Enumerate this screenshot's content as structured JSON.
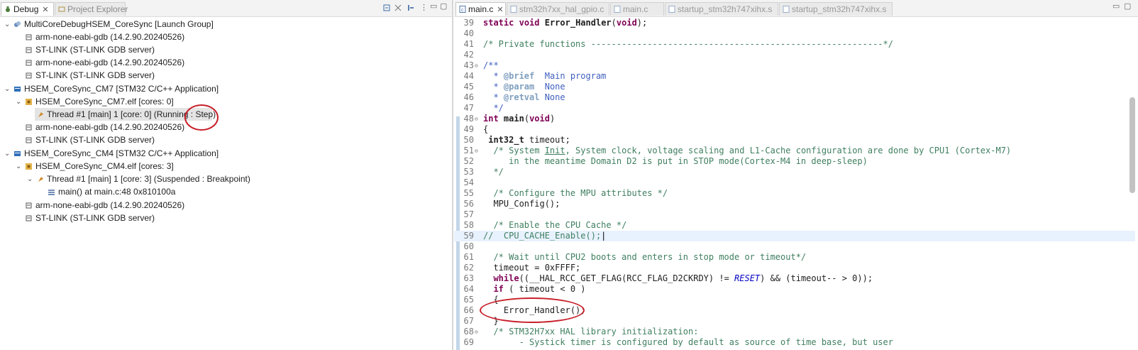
{
  "debug_view": {
    "tabs": [
      {
        "label": "Debug",
        "active": true,
        "closable": true
      },
      {
        "label": "Project Explorer",
        "active": false
      }
    ],
    "tree": [
      {
        "label": "MultiCoreDebugHSEM_CoreSync [Launch Group]",
        "level": 0,
        "expanded": true,
        "icon": "launch-group-icon"
      },
      {
        "label": "arm-none-eabi-gdb (14.2.90.20240526)",
        "level": 1,
        "icon": "debugger-process-icon"
      },
      {
        "label": "ST-LINK (ST-LINK GDB server)",
        "level": 1,
        "icon": "debugger-process-icon"
      },
      {
        "label": "arm-none-eabi-gdb (14.2.90.20240526)",
        "level": 1,
        "icon": "debugger-process-icon"
      },
      {
        "label": "ST-LINK (ST-LINK GDB server)",
        "level": 1,
        "icon": "debugger-process-icon"
      },
      {
        "label": "HSEM_CoreSync_CM7 [STM32 C/C++ Application]",
        "level": 0,
        "expanded": true,
        "icon": "launch-config-icon"
      },
      {
        "label": "HSEM_CoreSync_CM7.elf [cores: 0]",
        "level": 1,
        "expanded": true,
        "icon": "debug-target-icon"
      },
      {
        "label": "Thread #1 [main] 1 [core: 0] (Running : Step)",
        "level": 2,
        "selected": true,
        "icon": "thread-running-icon"
      },
      {
        "label": "arm-none-eabi-gdb (14.2.90.20240526)",
        "level": 1,
        "icon": "debugger-process-icon"
      },
      {
        "label": "ST-LINK (ST-LINK GDB server)",
        "level": 1,
        "icon": "debugger-process-icon"
      },
      {
        "label": "HSEM_CoreSync_CM4 [STM32 C/C++ Application]",
        "level": 0,
        "expanded": true,
        "icon": "launch-config-icon"
      },
      {
        "label": "HSEM_CoreSync_CM4.elf [cores: 3]",
        "level": 1,
        "expanded": true,
        "icon": "debug-target-icon"
      },
      {
        "label": "Thread #1 [main] 1 [core: 3] (Suspended : Breakpoint)",
        "level": 2,
        "expanded": true,
        "icon": "thread-suspended-icon"
      },
      {
        "label": "main() at main.c:48 0x810100a",
        "level": 3,
        "icon": "stack-frame-icon"
      },
      {
        "label": "arm-none-eabi-gdb (14.2.90.20240526)",
        "level": 1,
        "icon": "debugger-process-icon"
      },
      {
        "label": "ST-LINK (ST-LINK GDB server)",
        "level": 1,
        "icon": "debugger-process-icon"
      }
    ]
  },
  "editor": {
    "tabs": [
      {
        "label": "main.c",
        "active": true,
        "closable": true
      },
      {
        "label": "stm32h7xx_hal_gpio.c",
        "active": false
      },
      {
        "label": "main.c",
        "active": false
      },
      {
        "label": "startup_stm32h747xihx.s",
        "active": false
      },
      {
        "label": "startup_stm32h747xihx.s",
        "active": false
      }
    ],
    "current_line": "59",
    "lines": [
      {
        "n": "39",
        "text": "static void Error_Handler(void);"
      },
      {
        "n": "40",
        "text": ""
      },
      {
        "n": "41",
        "text": "/* Private functions ---------------------------------------------------------*/"
      },
      {
        "n": "42",
        "text": ""
      },
      {
        "n": "43",
        "text": "/**"
      },
      {
        "n": "44",
        "text": "  * @brief  Main program"
      },
      {
        "n": "45",
        "text": "  * @param  None"
      },
      {
        "n": "46",
        "text": "  * @retval None"
      },
      {
        "n": "47",
        "text": "  */"
      },
      {
        "n": "48",
        "text": "int main(void)"
      },
      {
        "n": "49",
        "text": "{"
      },
      {
        "n": "50",
        "text": " int32_t timeout;"
      },
      {
        "n": "51",
        "text": "  /* System Init, System clock, voltage scaling and L1-Cache configuration are done by CPU1 (Cortex-M7)"
      },
      {
        "n": "52",
        "text": "     in the meantime Domain D2 is put in STOP mode(Cortex-M4 in deep-sleep)"
      },
      {
        "n": "53",
        "text": "  */"
      },
      {
        "n": "54",
        "text": ""
      },
      {
        "n": "55",
        "text": "  /* Configure the MPU attributes */"
      },
      {
        "n": "56",
        "text": "  MPU_Config();"
      },
      {
        "n": "57",
        "text": ""
      },
      {
        "n": "58",
        "text": "  /* Enable the CPU Cache */"
      },
      {
        "n": "59",
        "text": "//  CPU_CACHE_Enable();"
      },
      {
        "n": "60",
        "text": ""
      },
      {
        "n": "61",
        "text": "  /* Wait until CPU2 boots and enters in stop mode or timeout*/"
      },
      {
        "n": "62",
        "text": "  timeout = 0xFFFF;"
      },
      {
        "n": "63",
        "text": "  while((__HAL_RCC_GET_FLAG(RCC_FLAG_D2CKRDY) != RESET) && (timeout-- > 0));"
      },
      {
        "n": "64",
        "text": "  if ( timeout < 0 )"
      },
      {
        "n": "65",
        "text": "  {"
      },
      {
        "n": "66",
        "text": "    Error_Handler();"
      },
      {
        "n": "67",
        "text": "  }"
      },
      {
        "n": "68",
        "text": "  /* STM32H7xx HAL library initialization:"
      },
      {
        "n": "69",
        "text": "       - Systick timer is configured by default as source of time base, but user"
      }
    ]
  }
}
